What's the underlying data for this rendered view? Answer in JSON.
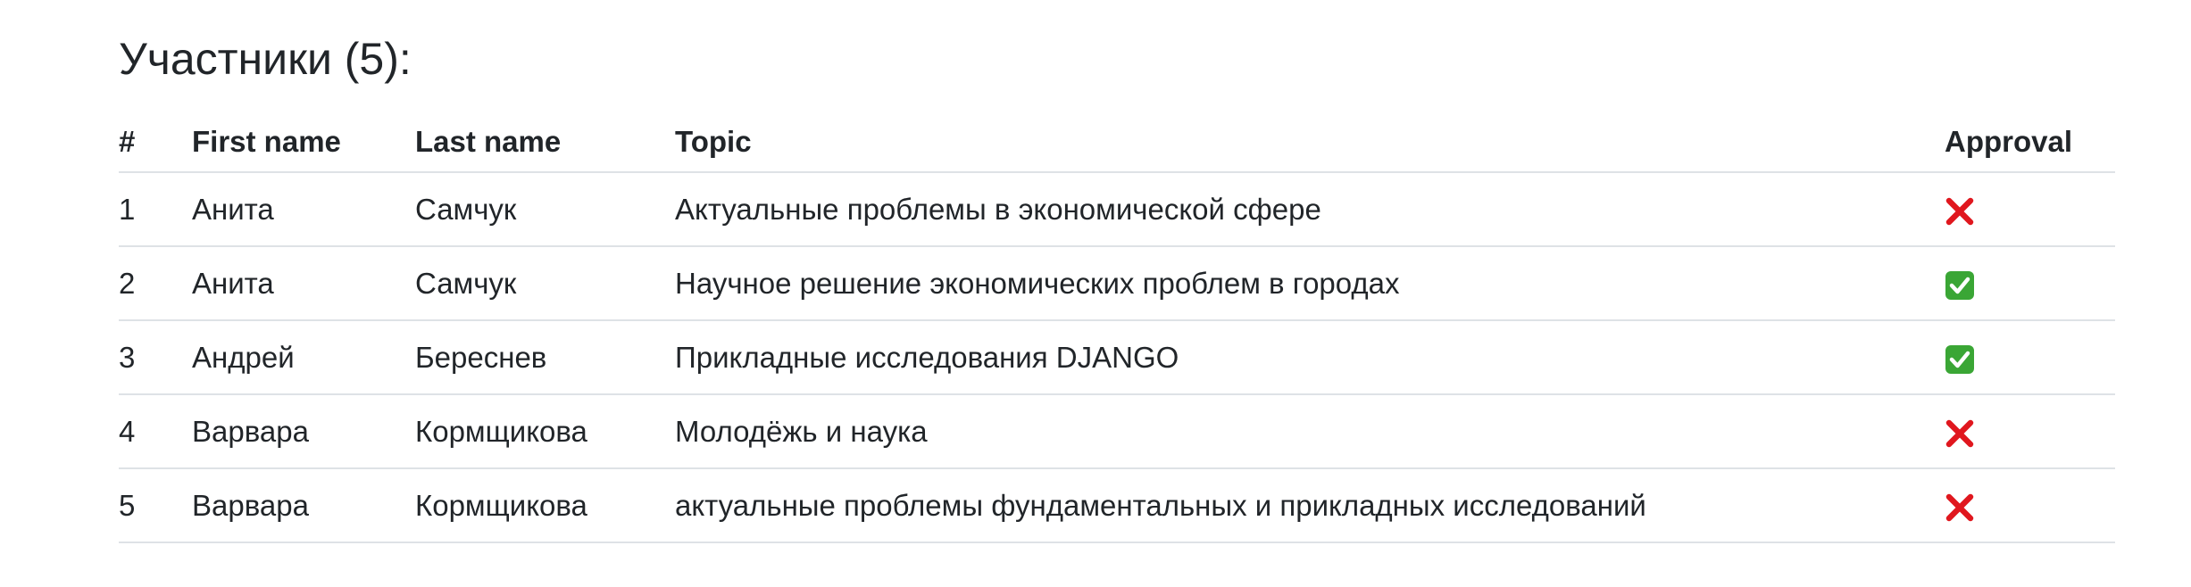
{
  "title": "Участники (5):",
  "columns": [
    "#",
    "First name",
    "Last name",
    "Topic",
    "Approval"
  ],
  "rows": [
    {
      "num": "1",
      "first": "Анита",
      "last": "Самчук",
      "topic": "Актуальные проблемы в экономической сфере",
      "approval": "cross-mark-icon"
    },
    {
      "num": "2",
      "first": "Анита",
      "last": "Самчук",
      "topic": "Научное решение экономических проблем в городах",
      "approval": "check-mark-icon"
    },
    {
      "num": "3",
      "first": "Андрей",
      "last": "Береснев",
      "topic": "Прикладные исследования DJANGO",
      "approval": "check-mark-icon"
    },
    {
      "num": "4",
      "first": "Варвара",
      "last": "Кормщикова",
      "topic": "Молодёжь и наука",
      "approval": "cross-mark-icon"
    },
    {
      "num": "5",
      "first": "Варвара",
      "last": "Кормщикова",
      "topic": "актуальные проблемы фундаментальных и прикладных исследований",
      "approval": "cross-mark-icon"
    }
  ],
  "colors": {
    "text": "#212529",
    "border": "#dee2e6",
    "cross": "#e0171e",
    "check": "#3aa635"
  }
}
